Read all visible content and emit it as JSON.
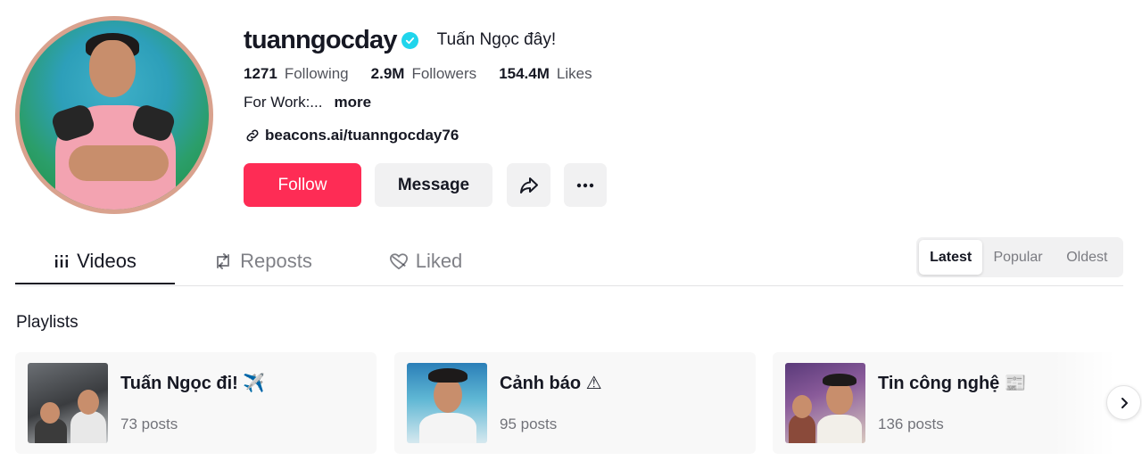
{
  "profile": {
    "username": "tuanngocday",
    "nickname": "Tuấn Ngọc đây!",
    "verified": true,
    "stats": {
      "following_count": "1271",
      "following_label": "Following",
      "followers_count": "2.9M",
      "followers_label": "Followers",
      "likes_count": "154.4M",
      "likes_label": "Likes"
    },
    "bio": "For Work:...",
    "bio_more": "more",
    "link": "beacons.ai/tuanngocday76"
  },
  "actions": {
    "follow_label": "Follow",
    "message_label": "Message",
    "share_icon": "share-icon",
    "more_icon": "more-icon"
  },
  "tabs": [
    {
      "label": "Videos",
      "icon": "grid-icon",
      "active": true
    },
    {
      "label": "Reposts",
      "icon": "repost-icon",
      "active": false
    },
    {
      "label": "Liked",
      "icon": "heart-icon",
      "active": false
    }
  ],
  "sort": {
    "options": [
      "Latest",
      "Popular",
      "Oldest"
    ],
    "selected": "Latest"
  },
  "playlists": {
    "heading": "Playlists",
    "items": [
      {
        "title": "Tuấn Ngọc đi! ✈️",
        "count": "73 posts"
      },
      {
        "title": "Cảnh báo ⚠",
        "count": "95 posts"
      },
      {
        "title": "Tin công nghệ 📰",
        "count": "136 posts"
      }
    ]
  },
  "colors": {
    "follow_bg": "#fe2c55",
    "verified": "#20d5ec",
    "secondary_bg": "#f1f1f2",
    "text_primary": "#161823"
  }
}
